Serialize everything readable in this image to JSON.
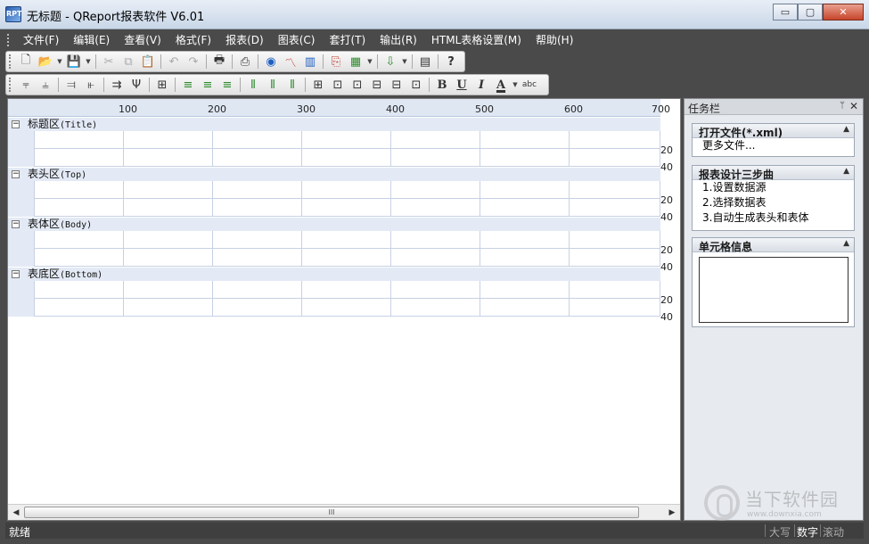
{
  "window": {
    "title": "无标题 - QReport报表软件 V6.01",
    "icon_label": "RPT",
    "minimize": "▭",
    "maximize": "▢",
    "close": "✕"
  },
  "menu": [
    "文件(F)",
    "编辑(E)",
    "查看(V)",
    "格式(F)",
    "报表(D)",
    "图表(C)",
    "套打(T)",
    "输出(R)",
    "HTML表格设置(M)",
    "帮助(H)"
  ],
  "toolbar1_icons": [
    "new-file-icon",
    "open-folder-icon",
    "save-icon",
    "cut-icon",
    "copy-icon",
    "paste-icon",
    "undo-icon",
    "redo-icon",
    "print-icon",
    "print-preview-icon",
    "globe-chart-icon",
    "line-chart-icon",
    "bar-chart-icon",
    "pdf-export-icon",
    "excel-export-icon",
    "import-icon",
    "page-setup-icon",
    "help-icon"
  ],
  "toolbar2_icons": [
    "insert-row-icon",
    "insert-col-icon",
    "delete-row-icon",
    "delete-col-icon",
    "merge-icon",
    "split-icon",
    "table-icon",
    "align-left-icon",
    "align-center-icon",
    "align-right-icon",
    "valign-top-icon",
    "valign-middle-icon",
    "valign-bottom-icon",
    "all-borders-icon",
    "inner-borders-icon",
    "outer-borders-icon",
    "h-borders-icon",
    "v-borders-icon",
    "no-borders-icon",
    "bold-icon",
    "underline-icon",
    "italic-icon",
    "font-color-icon",
    "abc-icon"
  ],
  "format_buttons": {
    "bold": "B",
    "underline": "U",
    "italic": "I",
    "fontcolor": "A",
    "abc": "abc"
  },
  "ruler": [
    "100",
    "200",
    "300",
    "400",
    "500",
    "600",
    "700"
  ],
  "sections": [
    {
      "name": "标题区",
      "en": "(Title)"
    },
    {
      "name": "表头区",
      "en": "(Top)"
    },
    {
      "name": "表体区",
      "en": "(Body)"
    },
    {
      "name": "表底区",
      "en": "(Bottom)"
    }
  ],
  "row_labels": [
    "20",
    "40"
  ],
  "scroll_thumb": "III",
  "taskpane": {
    "title": "任务栏",
    "pin": "ᛘ",
    "close": "✕",
    "panels": [
      {
        "title": "打开文件(*.xml)",
        "items": [
          "更多文件..."
        ]
      },
      {
        "title": "报表设计三步曲",
        "items": [
          "1.设置数据源",
          "2.选择数据表",
          "3.自动生成表头和表体"
        ]
      },
      {
        "title": "单元格信息",
        "items": []
      }
    ]
  },
  "status": {
    "main": "就绪",
    "caps": "大写",
    "num": "数字",
    "scroll": "滚动"
  },
  "watermark": {
    "text": "当下软件园",
    "url": "www.downxia.com"
  }
}
